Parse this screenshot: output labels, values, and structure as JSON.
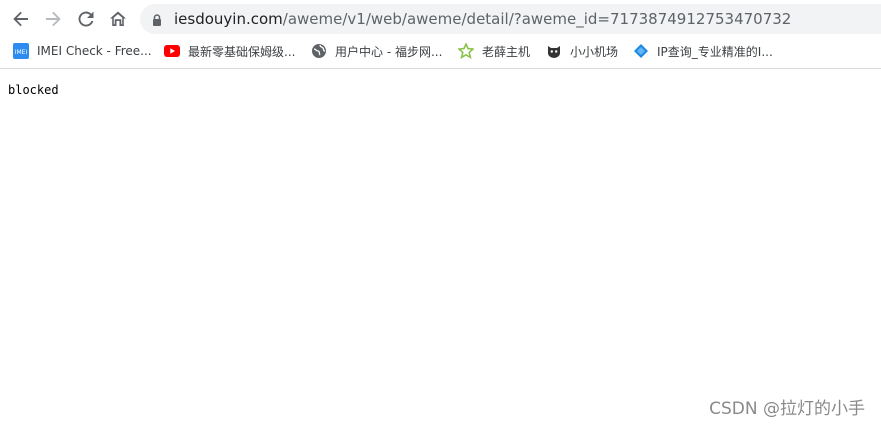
{
  "browser": {
    "url_host": "iesdouyin.com",
    "url_path": "/aweme/v1/web/aweme/detail/?aweme_id=7173874912753470732"
  },
  "bookmarks": [
    {
      "label": "IMEI Check - Free...",
      "icon": "imei-icon",
      "color": "#2d8cf0"
    },
    {
      "label": "最新零基础保姆级...",
      "icon": "youtube-icon",
      "color": "#ff0000"
    },
    {
      "label": "用户中心 - 福步网...",
      "icon": "globe-icon",
      "color": "#5f6368"
    },
    {
      "label": "老薛主机",
      "icon": "star-icon",
      "color": "#8bc34a"
    },
    {
      "label": "小小机场",
      "icon": "cat-icon",
      "color": "#333333"
    },
    {
      "label": "IP查询_专业精准的I...",
      "icon": "diamond-icon",
      "color": "#1e88e5"
    }
  ],
  "page": {
    "body_text": "blocked"
  },
  "watermark": "CSDN @拉灯的小手"
}
